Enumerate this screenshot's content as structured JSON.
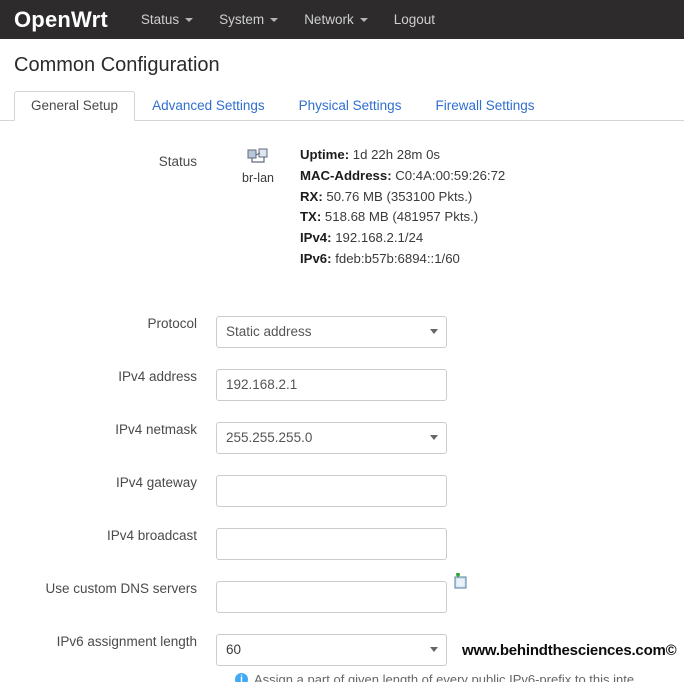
{
  "nav": {
    "brand": "OpenWrt",
    "items": [
      {
        "label": "Status",
        "caret": true
      },
      {
        "label": "System",
        "caret": true
      },
      {
        "label": "Network",
        "caret": true
      },
      {
        "label": "Logout",
        "caret": false
      }
    ]
  },
  "page": {
    "title": "Common Configuration"
  },
  "tabs": [
    {
      "label": "General Setup",
      "active": true
    },
    {
      "label": "Advanced Settings",
      "active": false
    },
    {
      "label": "Physical Settings",
      "active": false
    },
    {
      "label": "Firewall Settings",
      "active": false
    }
  ],
  "status": {
    "label": "Status",
    "interface_name": "br-lan",
    "icon": "ethernet-icon",
    "lines": [
      {
        "key": "Uptime:",
        "value": "1d 22h 28m 0s"
      },
      {
        "key": "MAC-Address:",
        "value": "C0:4A:00:59:26:72"
      },
      {
        "key": "RX:",
        "value": "50.76 MB (353100 Pkts.)"
      },
      {
        "key": "TX:",
        "value": "518.68 MB (481957 Pkts.)"
      },
      {
        "key": "IPv4:",
        "value": "192.168.2.1/24"
      },
      {
        "key": "IPv6:",
        "value": "fdeb:b57b:6894::1/60"
      }
    ]
  },
  "form": {
    "protocol": {
      "label": "Protocol",
      "value": "Static address",
      "type": "select"
    },
    "ipv4_address": {
      "label": "IPv4 address",
      "value": "192.168.2.1",
      "type": "text"
    },
    "ipv4_netmask": {
      "label": "IPv4 netmask",
      "value": "255.255.255.0",
      "type": "select"
    },
    "ipv4_gateway": {
      "label": "IPv4 gateway",
      "value": "",
      "type": "text"
    },
    "ipv4_broadcast": {
      "label": "IPv4 broadcast",
      "value": "",
      "type": "text"
    },
    "custom_dns": {
      "label": "Use custom DNS servers",
      "value": "",
      "type": "text",
      "add_icon": "add-entry-icon"
    },
    "ipv6_assignment_length": {
      "label": "IPv6 assignment length",
      "value": "60",
      "type": "select",
      "help": "Assign a part of given length of every public IPv6-prefix to this inte",
      "help_icon": "info-icon"
    }
  },
  "watermark": {
    "text": "www.behindthesciences.com©"
  },
  "colors": {
    "nav_bg": "#2d2b2b",
    "link": "#2f6fd0",
    "border": "#cccccc",
    "info": "#3fa9f5"
  }
}
